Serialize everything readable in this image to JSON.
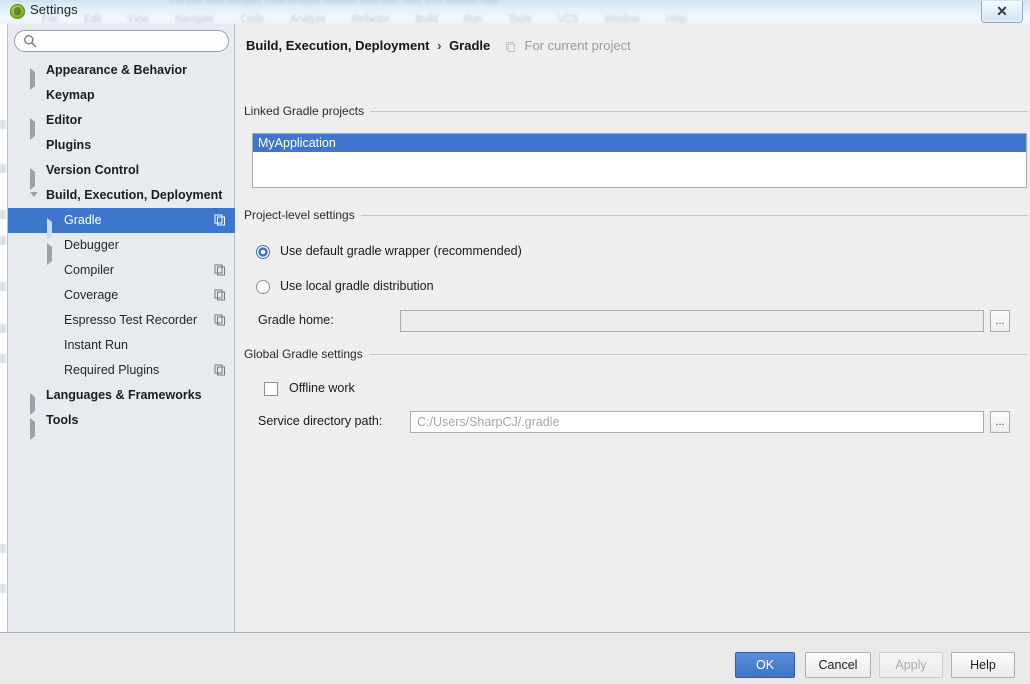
{
  "window": {
    "title": "Settings",
    "close_label": "✕",
    "app_icon": "android-studio-icon",
    "ghost_menu": [
      "File",
      "Edit",
      "View",
      "Navigate",
      "Code",
      "Analyze",
      "Refactor",
      "Build",
      "Run",
      "Tools",
      "VCS",
      "Window",
      "Help"
    ]
  },
  "sidebar": {
    "search": {
      "value": "",
      "placeholder": ""
    },
    "items": [
      {
        "label": "Appearance & Behavior",
        "level": 0,
        "twisty": "right",
        "bold": true,
        "selected": false,
        "scope_icon": false
      },
      {
        "label": "Keymap",
        "level": 0,
        "twisty": "none",
        "bold": true,
        "selected": false,
        "scope_icon": false
      },
      {
        "label": "Editor",
        "level": 0,
        "twisty": "right",
        "bold": true,
        "selected": false,
        "scope_icon": false
      },
      {
        "label": "Plugins",
        "level": 0,
        "twisty": "none",
        "bold": true,
        "selected": false,
        "scope_icon": false
      },
      {
        "label": "Version Control",
        "level": 0,
        "twisty": "right",
        "bold": true,
        "selected": false,
        "scope_icon": false
      },
      {
        "label": "Build, Execution, Deployment",
        "level": 0,
        "twisty": "down",
        "bold": true,
        "selected": false,
        "scope_icon": false
      },
      {
        "label": "Gradle",
        "level": 1,
        "twisty": "right",
        "bold": false,
        "selected": true,
        "scope_icon": true
      },
      {
        "label": "Debugger",
        "level": 1,
        "twisty": "right",
        "bold": false,
        "selected": false,
        "scope_icon": false
      },
      {
        "label": "Compiler",
        "level": 1,
        "twisty": "none",
        "bold": false,
        "selected": false,
        "scope_icon": true
      },
      {
        "label": "Coverage",
        "level": 1,
        "twisty": "none",
        "bold": false,
        "selected": false,
        "scope_icon": true
      },
      {
        "label": "Espresso Test Recorder",
        "level": 1,
        "twisty": "none",
        "bold": false,
        "selected": false,
        "scope_icon": true
      },
      {
        "label": "Instant Run",
        "level": 1,
        "twisty": "none",
        "bold": false,
        "selected": false,
        "scope_icon": false
      },
      {
        "label": "Required Plugins",
        "level": 1,
        "twisty": "none",
        "bold": false,
        "selected": false,
        "scope_icon": true
      },
      {
        "label": "Languages & Frameworks",
        "level": 0,
        "twisty": "right",
        "bold": true,
        "selected": false,
        "scope_icon": false
      },
      {
        "label": "Tools",
        "level": 0,
        "twisty": "right",
        "bold": true,
        "selected": false,
        "scope_icon": false
      }
    ]
  },
  "content": {
    "breadcrumb": {
      "parent": "Build, Execution, Deployment",
      "separator": "›",
      "current": "Gradle",
      "scope_note": "For current project"
    },
    "linked_projects": {
      "group_title": "Linked Gradle projects",
      "items": [
        {
          "label": "MyApplication",
          "selected": true
        }
      ]
    },
    "project_level_settings": {
      "group_title": "Project-level settings",
      "radios": [
        {
          "label": "Use default gradle wrapper (recommended)",
          "checked": true
        },
        {
          "label": "Use local gradle distribution",
          "checked": false
        }
      ],
      "gradle_home": {
        "label": "Gradle home:",
        "value": "",
        "placeholder": "",
        "disabled": true,
        "browse_label": "..."
      }
    },
    "global_gradle_settings": {
      "group_title": "Global Gradle settings",
      "offline_work": {
        "label": "Offline work",
        "checked": false
      },
      "service_directory_path": {
        "label": "Service directory path:",
        "value": "",
        "placeholder": "C:/Users/SharpCJ/.gradle",
        "browse_label": "..."
      }
    }
  },
  "footer": {
    "buttons": [
      {
        "label": "OK",
        "kind": "primary"
      },
      {
        "label": "Cancel",
        "kind": "normal"
      },
      {
        "label": "Apply",
        "kind": "disabled"
      },
      {
        "label": "Help",
        "kind": "normal"
      }
    ]
  },
  "colors": {
    "accent_blue": "#3d76cc",
    "dialog_bg": "#eeeeee",
    "sidebar_bg": "#e7eaee",
    "footer_bg": "#e9e9e9",
    "field_border": "#a8acb1"
  }
}
